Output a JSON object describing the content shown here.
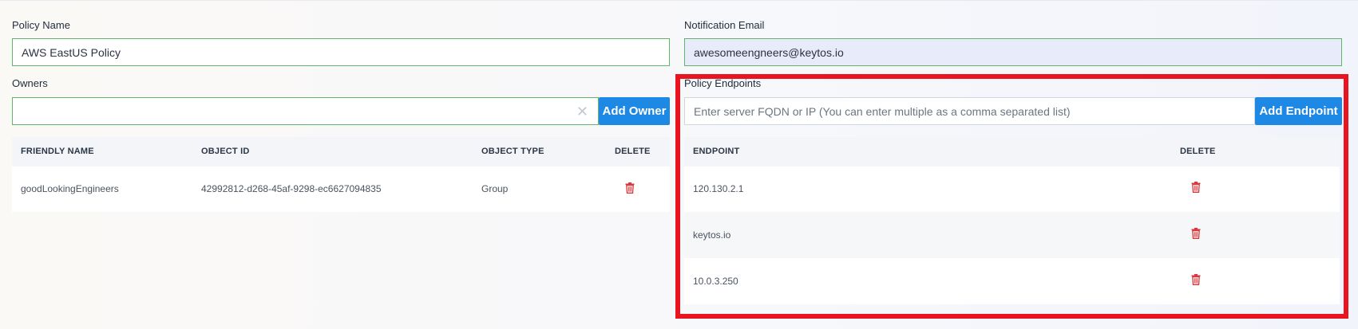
{
  "policy_name": {
    "label": "Policy Name",
    "value": "AWS EastUS Policy"
  },
  "notification_email": {
    "label": "Notification Email",
    "value": "awesomeengneers@keytos.io"
  },
  "owners": {
    "label": "Owners",
    "input_value": "",
    "clear_glyph": "✕",
    "add_button": "Add Owner",
    "columns": [
      "FRIENDLY NAME",
      "OBJECT ID",
      "OBJECT TYPE",
      "DELETE"
    ],
    "rows": [
      {
        "friendly_name": "goodLookingEngineers",
        "object_id": "42992812-d268-45af-9298-ec6627094835",
        "object_type": "Group"
      }
    ]
  },
  "endpoints": {
    "label": "Policy Endpoints",
    "placeholder": "Enter server FQDN or IP (You can enter multiple as a comma separated list)",
    "add_button": "Add Endpoint",
    "columns": [
      "ENDPOINT",
      "DELETE"
    ],
    "rows": [
      {
        "endpoint": "120.130.2.1"
      },
      {
        "endpoint": "keytos.io"
      },
      {
        "endpoint": "10.0.3.250"
      }
    ]
  },
  "colors": {
    "accent": "#1e88e5",
    "valid_border": "#5fb56a",
    "delete_icon": "#d9383c",
    "highlight_frame": "#e8141f"
  },
  "icons": {
    "delete": "trash-icon",
    "clear": "close-icon"
  }
}
